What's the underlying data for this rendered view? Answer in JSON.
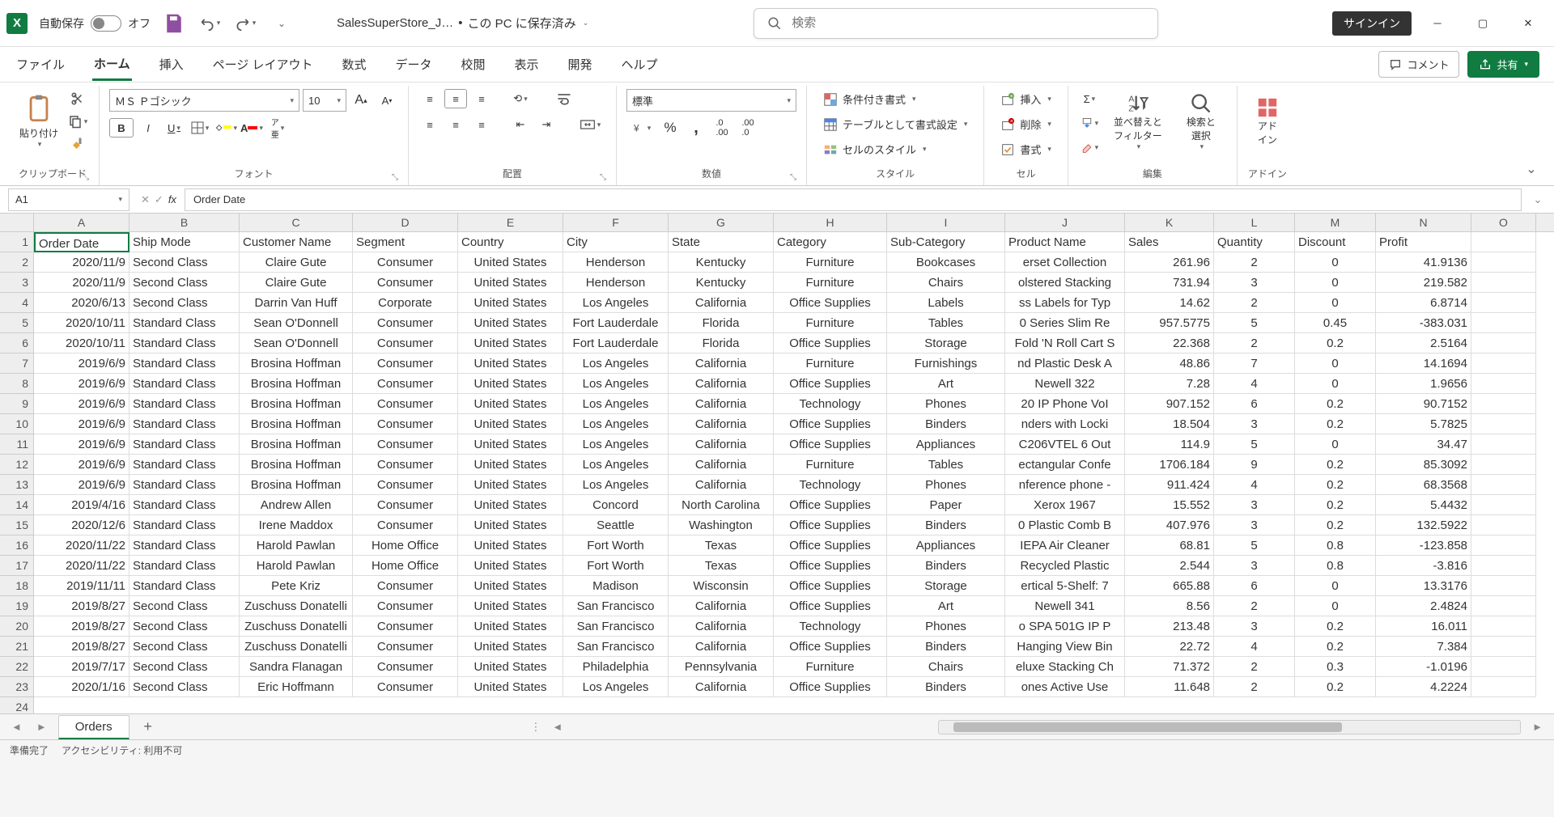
{
  "title": {
    "autosave_label": "自動保存",
    "autosave_state": "オフ",
    "doc_name": "SalesSuperStore_J…",
    "saved_loc": "この PC に保存済み",
    "search_placeholder": "検索",
    "signin": "サインイン"
  },
  "tabs": [
    "ファイル",
    "ホーム",
    "挿入",
    "ページ レイアウト",
    "数式",
    "データ",
    "校閲",
    "表示",
    "開発",
    "ヘルプ"
  ],
  "tabs_active": 1,
  "comment_btn": "コメント",
  "share_btn": "共有",
  "ribbon": {
    "clipboard": {
      "paste": "貼り付け",
      "label": "クリップボード"
    },
    "font": {
      "name": "ＭＳ Ｐゴシック",
      "size": "10",
      "label": "フォント"
    },
    "align": {
      "wrap": "折り返",
      "merge": "結合",
      "label": "配置"
    },
    "number": {
      "format": "標準",
      "label": "数値"
    },
    "styles": {
      "cond": "条件付き書式",
      "table": "テーブルとして書式設定",
      "cell": "セルのスタイル",
      "label": "スタイル"
    },
    "cells": {
      "insert": "挿入",
      "delete": "削除",
      "format": "書式",
      "label": "セル"
    },
    "editing": {
      "sort": "並べ替えと\nフィルター",
      "find": "検索と\n選択",
      "label": "編集"
    },
    "addins": {
      "addin": "アド\nイン",
      "label": "アドイン"
    }
  },
  "namebox": "A1",
  "formula": "Order Date",
  "columns": [
    "A",
    "B",
    "C",
    "D",
    "E",
    "F",
    "G",
    "H",
    "I",
    "J",
    "K",
    "L",
    "M",
    "N",
    "O"
  ],
  "col_classes": [
    "cA",
    "cB",
    "cC",
    "cD",
    "cE",
    "cF",
    "cG",
    "cH",
    "cI",
    "cJ",
    "cK",
    "cL",
    "cM",
    "cN",
    "cO"
  ],
  "headers": [
    "Order Date",
    "Ship Mode",
    "Customer Name",
    "Segment",
    "Country",
    "City",
    "State",
    "Category",
    "Sub-Category",
    "Product Name",
    "Sales",
    "Quantity",
    "Discount",
    "Profit",
    ""
  ],
  "rows": [
    [
      "2020/11/9",
      "Second Class",
      "Claire Gute",
      "Consumer",
      "United States",
      "Henderson",
      "Kentucky",
      "Furniture",
      "Bookcases",
      "erset Collection",
      "261.96",
      "2",
      "0",
      "41.9136",
      ""
    ],
    [
      "2020/11/9",
      "Second Class",
      "Claire Gute",
      "Consumer",
      "United States",
      "Henderson",
      "Kentucky",
      "Furniture",
      "Chairs",
      "olstered Stacking",
      "731.94",
      "3",
      "0",
      "219.582",
      ""
    ],
    [
      "2020/6/13",
      "Second Class",
      "Darrin Van Huff",
      "Corporate",
      "United States",
      "Los Angeles",
      "California",
      "Office Supplies",
      "Labels",
      "ss Labels for Typ",
      "14.62",
      "2",
      "0",
      "6.8714",
      ""
    ],
    [
      "2020/10/11",
      "Standard Class",
      "Sean O'Donnell",
      "Consumer",
      "United States",
      "Fort Lauderdale",
      "Florida",
      "Furniture",
      "Tables",
      "0 Series Slim Re",
      "957.5775",
      "5",
      "0.45",
      "-383.031",
      ""
    ],
    [
      "2020/10/11",
      "Standard Class",
      "Sean O'Donnell",
      "Consumer",
      "United States",
      "Fort Lauderdale",
      "Florida",
      "Office Supplies",
      "Storage",
      "Fold 'N Roll Cart S",
      "22.368",
      "2",
      "0.2",
      "2.5164",
      ""
    ],
    [
      "2019/6/9",
      "Standard Class",
      "Brosina Hoffman",
      "Consumer",
      "United States",
      "Los Angeles",
      "California",
      "Furniture",
      "Furnishings",
      "nd Plastic Desk A",
      "48.86",
      "7",
      "0",
      "14.1694",
      ""
    ],
    [
      "2019/6/9",
      "Standard Class",
      "Brosina Hoffman",
      "Consumer",
      "United States",
      "Los Angeles",
      "California",
      "Office Supplies",
      "Art",
      "Newell 322",
      "7.28",
      "4",
      "0",
      "1.9656",
      ""
    ],
    [
      "2019/6/9",
      "Standard Class",
      "Brosina Hoffman",
      "Consumer",
      "United States",
      "Los Angeles",
      "California",
      "Technology",
      "Phones",
      "20 IP Phone VoI",
      "907.152",
      "6",
      "0.2",
      "90.7152",
      ""
    ],
    [
      "2019/6/9",
      "Standard Class",
      "Brosina Hoffman",
      "Consumer",
      "United States",
      "Los Angeles",
      "California",
      "Office Supplies",
      "Binders",
      "nders with Locki",
      "18.504",
      "3",
      "0.2",
      "5.7825",
      ""
    ],
    [
      "2019/6/9",
      "Standard Class",
      "Brosina Hoffman",
      "Consumer",
      "United States",
      "Los Angeles",
      "California",
      "Office Supplies",
      "Appliances",
      "C206VTEL 6 Out",
      "114.9",
      "5",
      "0",
      "34.47",
      ""
    ],
    [
      "2019/6/9",
      "Standard Class",
      "Brosina Hoffman",
      "Consumer",
      "United States",
      "Los Angeles",
      "California",
      "Furniture",
      "Tables",
      "ectangular Confe",
      "1706.184",
      "9",
      "0.2",
      "85.3092",
      ""
    ],
    [
      "2019/6/9",
      "Standard Class",
      "Brosina Hoffman",
      "Consumer",
      "United States",
      "Los Angeles",
      "California",
      "Technology",
      "Phones",
      "nference phone -",
      "911.424",
      "4",
      "0.2",
      "68.3568",
      ""
    ],
    [
      "2019/4/16",
      "Standard Class",
      "Andrew Allen",
      "Consumer",
      "United States",
      "Concord",
      "North Carolina",
      "Office Supplies",
      "Paper",
      "Xerox 1967",
      "15.552",
      "3",
      "0.2",
      "5.4432",
      ""
    ],
    [
      "2020/12/6",
      "Standard Class",
      "Irene Maddox",
      "Consumer",
      "United States",
      "Seattle",
      "Washington",
      "Office Supplies",
      "Binders",
      "0 Plastic Comb B",
      "407.976",
      "3",
      "0.2",
      "132.5922",
      ""
    ],
    [
      "2020/11/22",
      "Standard Class",
      "Harold Pawlan",
      "Home Office",
      "United States",
      "Fort Worth",
      "Texas",
      "Office Supplies",
      "Appliances",
      "IEPA Air Cleaner",
      "68.81",
      "5",
      "0.8",
      "-123.858",
      ""
    ],
    [
      "2020/11/22",
      "Standard Class",
      "Harold Pawlan",
      "Home Office",
      "United States",
      "Fort Worth",
      "Texas",
      "Office Supplies",
      "Binders",
      "Recycled Plastic",
      "2.544",
      "3",
      "0.8",
      "-3.816",
      ""
    ],
    [
      "2019/11/11",
      "Standard Class",
      "Pete Kriz",
      "Consumer",
      "United States",
      "Madison",
      "Wisconsin",
      "Office Supplies",
      "Storage",
      "ertical 5-Shelf: 7",
      "665.88",
      "6",
      "0",
      "13.3176",
      ""
    ],
    [
      "2019/8/27",
      "Second Class",
      "Zuschuss Donatelli",
      "Consumer",
      "United States",
      "San Francisco",
      "California",
      "Office Supplies",
      "Art",
      "Newell 341",
      "8.56",
      "2",
      "0",
      "2.4824",
      ""
    ],
    [
      "2019/8/27",
      "Second Class",
      "Zuschuss Donatelli",
      "Consumer",
      "United States",
      "San Francisco",
      "California",
      "Technology",
      "Phones",
      "o SPA 501G IP P",
      "213.48",
      "3",
      "0.2",
      "16.011",
      ""
    ],
    [
      "2019/8/27",
      "Second Class",
      "Zuschuss Donatelli",
      "Consumer",
      "United States",
      "San Francisco",
      "California",
      "Office Supplies",
      "Binders",
      "Hanging View Bin",
      "22.72",
      "4",
      "0.2",
      "7.384",
      ""
    ],
    [
      "2019/7/17",
      "Second Class",
      "Sandra Flanagan",
      "Consumer",
      "United States",
      "Philadelphia",
      "Pennsylvania",
      "Furniture",
      "Chairs",
      "eluxe Stacking Ch",
      "71.372",
      "2",
      "0.3",
      "-1.0196",
      ""
    ],
    [
      "2020/1/16",
      "Second Class",
      "Eric Hoffmann",
      "Consumer",
      "United States",
      "Los Angeles",
      "California",
      "Office Supplies",
      "Binders",
      "ones Active Use",
      "11.648",
      "2",
      "0.2",
      "4.2224",
      ""
    ]
  ],
  "align": [
    "r",
    "l",
    "c",
    "c",
    "c",
    "c",
    "c",
    "c",
    "c",
    "c",
    "r",
    "c",
    "c",
    "r",
    "l"
  ],
  "sheet_tab": "Orders",
  "status": {
    "ready": "準備完了",
    "access": "アクセシビリティ: 利用不可"
  }
}
